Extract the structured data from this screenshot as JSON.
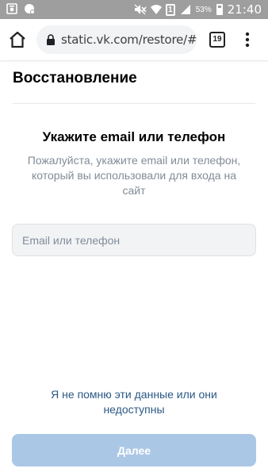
{
  "status_bar": {
    "battery_percent": "53%",
    "time": "21:40",
    "sim_label": "1"
  },
  "browser": {
    "url": "static.vk.com/restore/#/",
    "tab_count": "19"
  },
  "page": {
    "title": "Восстановление",
    "heading": "Укажите email или телефон",
    "subtitle": "Пожалуйста, укажите email или телефон, который вы использовали для входа на сайт",
    "input": {
      "value": "",
      "placeholder": "Email или телефон"
    },
    "forgot_link": "Я не помню эти данные или они недоступны",
    "next_button": "Далее"
  },
  "colors": {
    "accent_link": "#2a5885",
    "button_disabled": "#abc7e6",
    "status_bar": "#9e9e9e",
    "muted_text": "#818c99"
  },
  "icons": [
    "photo-icon",
    "chat-icon",
    "mute-icon",
    "wifi-icon",
    "sim-icon",
    "signal-icon",
    "battery-icon",
    "home-icon",
    "lock-icon",
    "tabs-icon",
    "menu-icon"
  ]
}
